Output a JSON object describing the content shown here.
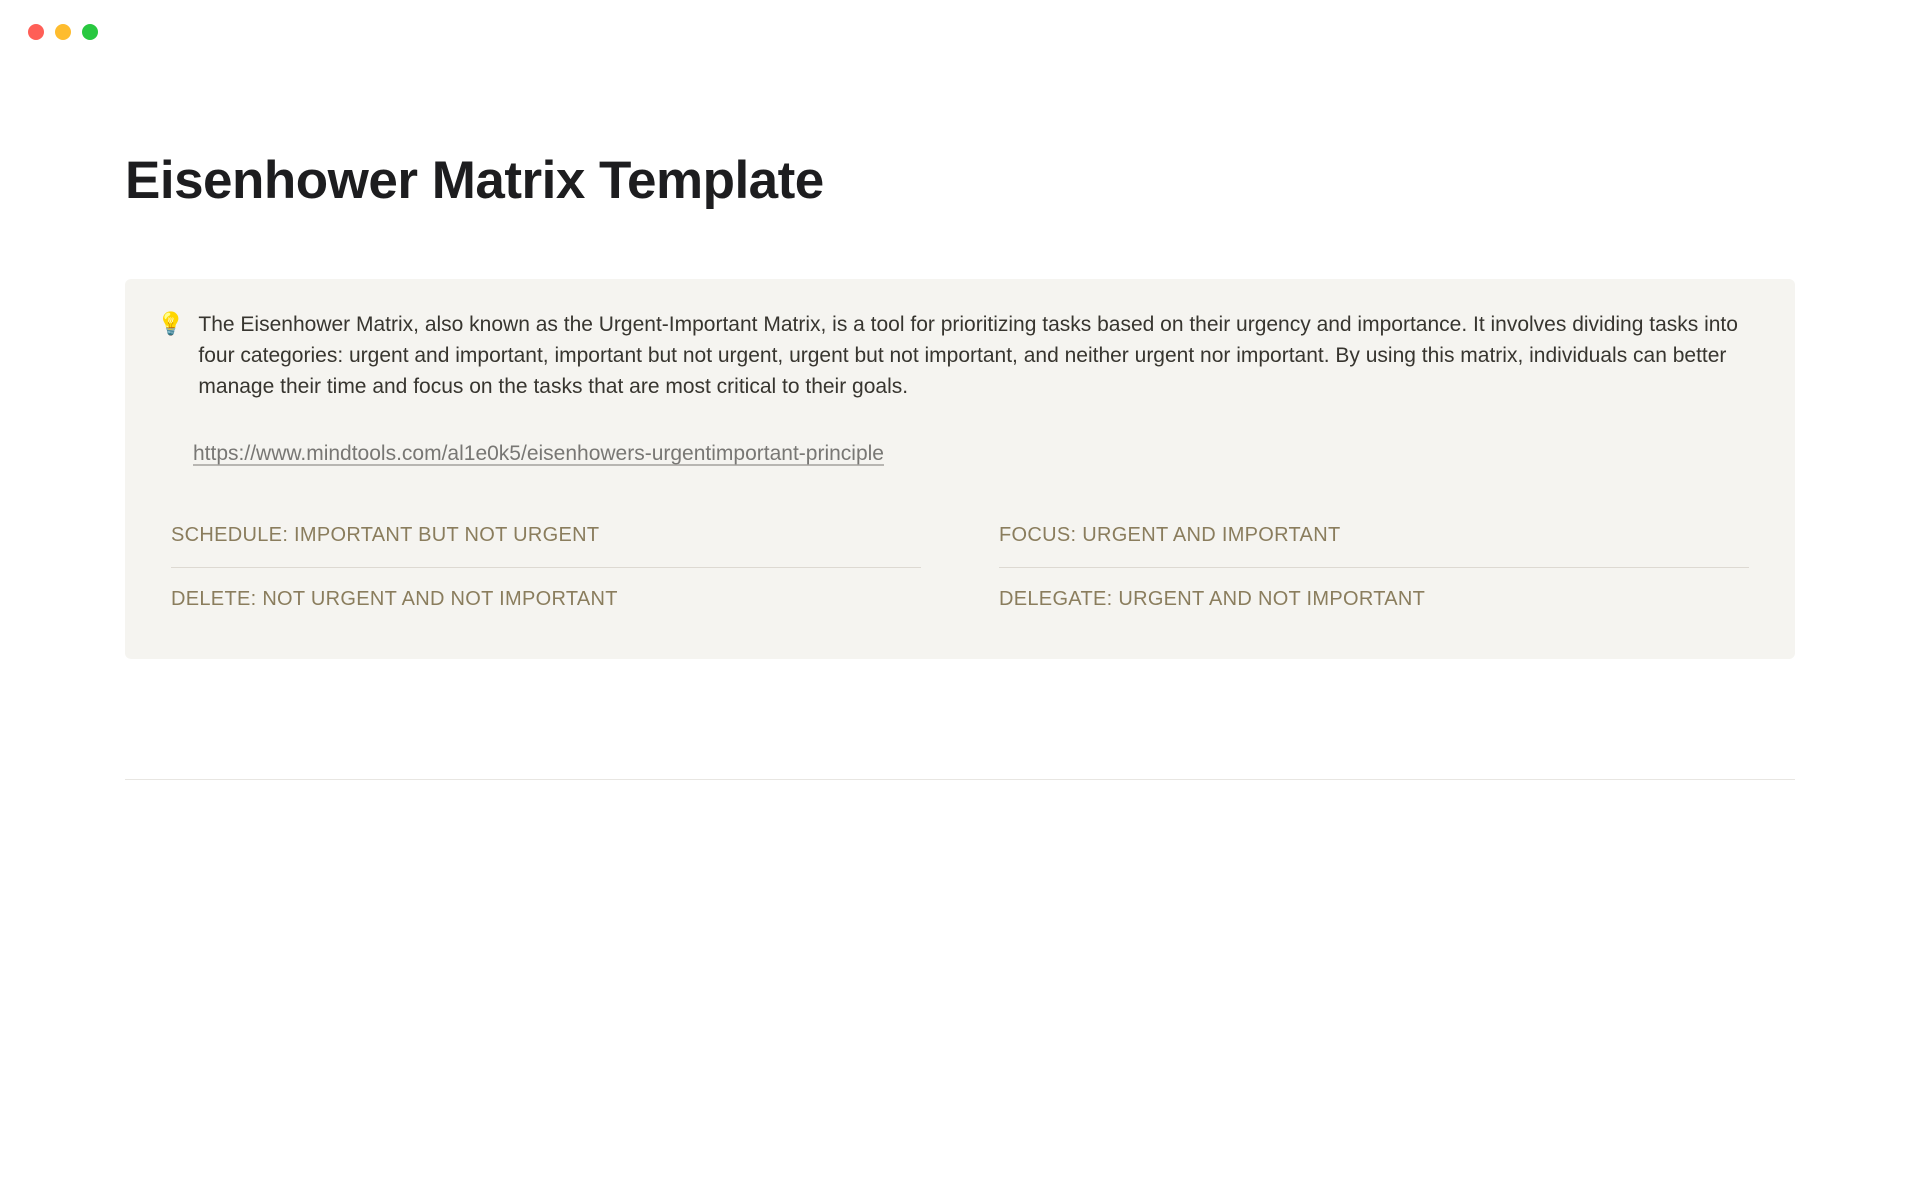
{
  "page": {
    "title": "Eisenhower Matrix Template"
  },
  "callout": {
    "icon": "💡",
    "description": "The Eisenhower Matrix, also known as the Urgent-Important Matrix, is a tool for prioritizing tasks based on their urgency and importance. It involves dividing tasks into four categories: urgent and important, important but not urgent, urgent but not important, and neither urgent nor important. By using this matrix, individuals can better manage their time and focus on the tasks that are most critical to their goals.",
    "link": "https://www.mindtools.com/al1e0k5/eisenhowers-urgentimportant-principle"
  },
  "matrix": {
    "schedule": "SCHEDULE: IMPORTANT BUT NOT URGENT",
    "focus": "FOCUS: URGENT AND IMPORTANT",
    "delete": "DELETE: NOT URGENT AND NOT IMPORTANT",
    "delegate": "DELEGATE: URGENT AND NOT IMPORTANT"
  }
}
